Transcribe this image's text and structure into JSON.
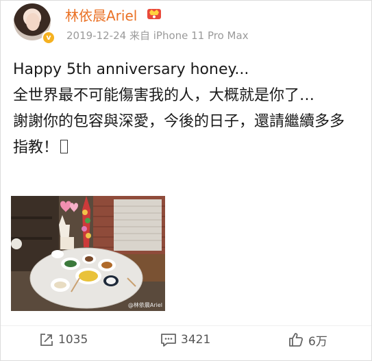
{
  "user": {
    "name": "林依晨Ariel",
    "timestamp": "2019-12-24",
    "source": "来自 iPhone 11 Pro Max",
    "verified_color": "#f5b120",
    "name_color": "#ea7125"
  },
  "post": {
    "line1": "Happy 5th anniversary honey...",
    "line2": "全世界最不可能傷害我的人，大概就是你了…",
    "line3": "謝謝你的包容與深愛，今後的日子，還請繼續多多指教！",
    "photo_watermark": "@林依晨Ariel"
  },
  "actions": {
    "repost": "1035",
    "comment": "3421",
    "like": "6万"
  },
  "icons": {
    "vip": "vip-badge-icon",
    "repost": "share-icon",
    "comment": "comment-icon",
    "like": "thumbs-up-icon"
  }
}
